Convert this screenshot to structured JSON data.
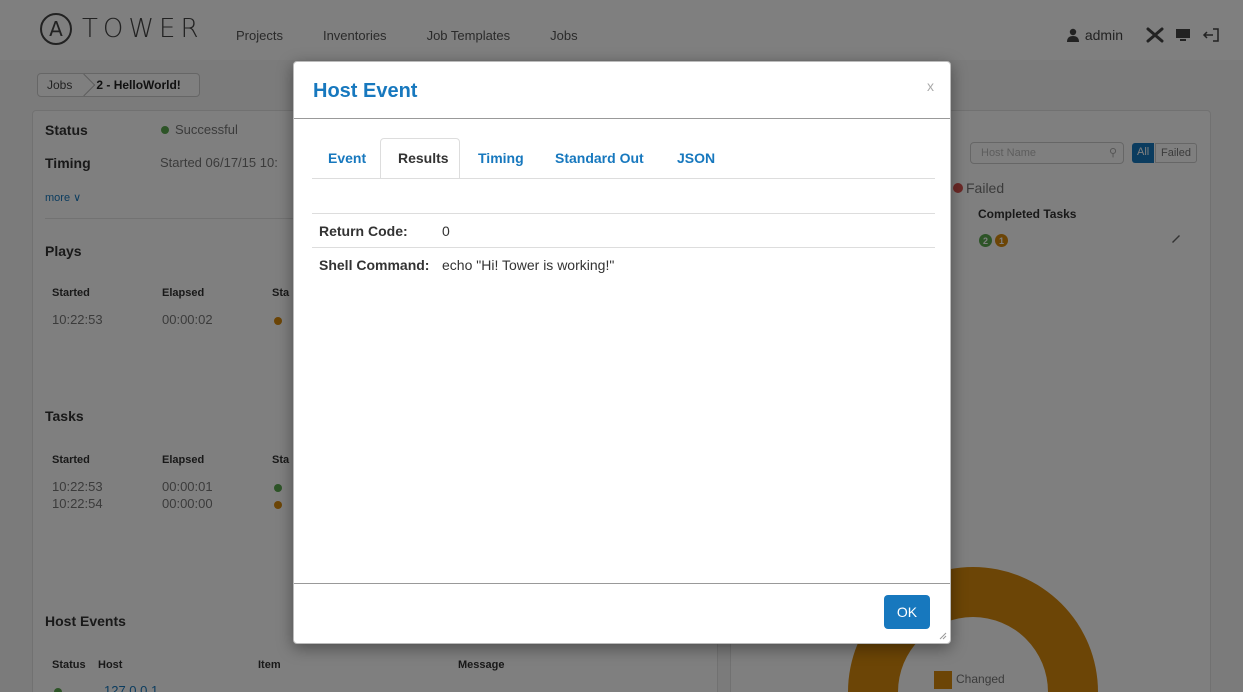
{
  "app": {
    "logo_letter": "A",
    "logo_text": "TOWER"
  },
  "nav": {
    "links": [
      "Projects",
      "Inventories",
      "Job Templates",
      "Jobs"
    ],
    "user": "admin"
  },
  "breadcrumb": {
    "items": [
      "Jobs",
      "2 - HelloWorld!"
    ]
  },
  "job_summary": {
    "status_label": "Status",
    "status_value": "Successful",
    "timing_label": "Timing",
    "timing_value": "Started 06/17/15 10:",
    "more_link": "more ∨"
  },
  "plays": {
    "title": "Plays",
    "columns": [
      "Started",
      "Elapsed",
      "Sta"
    ],
    "rows": [
      {
        "started": "10:22:53",
        "elapsed": "00:00:02",
        "status_color": "#d88a0d"
      }
    ]
  },
  "tasks": {
    "title": "Tasks",
    "columns": [
      "Started",
      "Elapsed",
      "Sta"
    ],
    "rows": [
      {
        "started": "10:22:53",
        "elapsed": "00:00:01",
        "status_color": "#5aa94f"
      },
      {
        "started": "10:22:54",
        "elapsed": "00:00:00",
        "status_color": "#d88a0d"
      }
    ]
  },
  "host_events": {
    "title": "Host Events",
    "columns": [
      "Status",
      "Host",
      "Item",
      "Message"
    ],
    "first_host": "127.0.0.1"
  },
  "host_summary": {
    "search_placeholder": "Host Name",
    "filter_all": "All",
    "filter_failed": "Failed",
    "legend_failed": "Failed",
    "completed_tasks_header": "Completed Tasks",
    "ok_count": "2",
    "changed_count": "1",
    "chart_legend_changed": "Changed"
  },
  "modal": {
    "title": "Host Event",
    "close": "x",
    "tabs": [
      "Event",
      "Results",
      "Timing",
      "Standard Out",
      "JSON"
    ],
    "active_tab": "Results",
    "rows": [
      {
        "key": "Return Code:",
        "value": "0"
      },
      {
        "key": "Shell Command:",
        "value": "echo \"Hi! Tower is working!\""
      }
    ],
    "ok_label": "OK"
  },
  "colors": {
    "accent": "#1778be",
    "success": "#5aa94f",
    "changed": "#d88a0d",
    "failed": "#d9534f"
  }
}
